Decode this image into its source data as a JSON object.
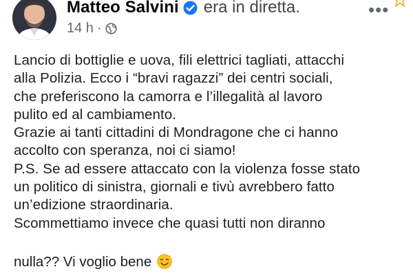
{
  "post": {
    "author": "Matteo Salvini",
    "status": "era in diretta.",
    "time": "14 h",
    "separator": "·",
    "privacy_icon": "globe-icon",
    "more_label": "•••",
    "body": "Lancio di bottiglie e uova, fili elettrici tagliati, attacchi\nalla Polizia. Ecco i “bravi ragazzi” dei centri sociali,\nche preferiscono la camorra e l’illegalità al lavoro\npulito ed al cambiamento.\nGrazie ai tanti cittadini di Mondragone che ci hanno\naccolto con speranza, noi ci siamo!\nP.S. Se ad essere attaccato con la violenza fosse stato\nun politico di sinistra, giornali e tivù avrebbero fatto\nun’edizione straordinaria.\nScommettiamo invece che quasi tutti non diranno",
    "last_line": "nulla?? Vi voglio bene",
    "emoji": "smiling-face-emoji"
  },
  "colors": {
    "verified": "#1877f2",
    "meta": "#65676b",
    "text": "#1c1e21",
    "star": "#f5a623"
  }
}
